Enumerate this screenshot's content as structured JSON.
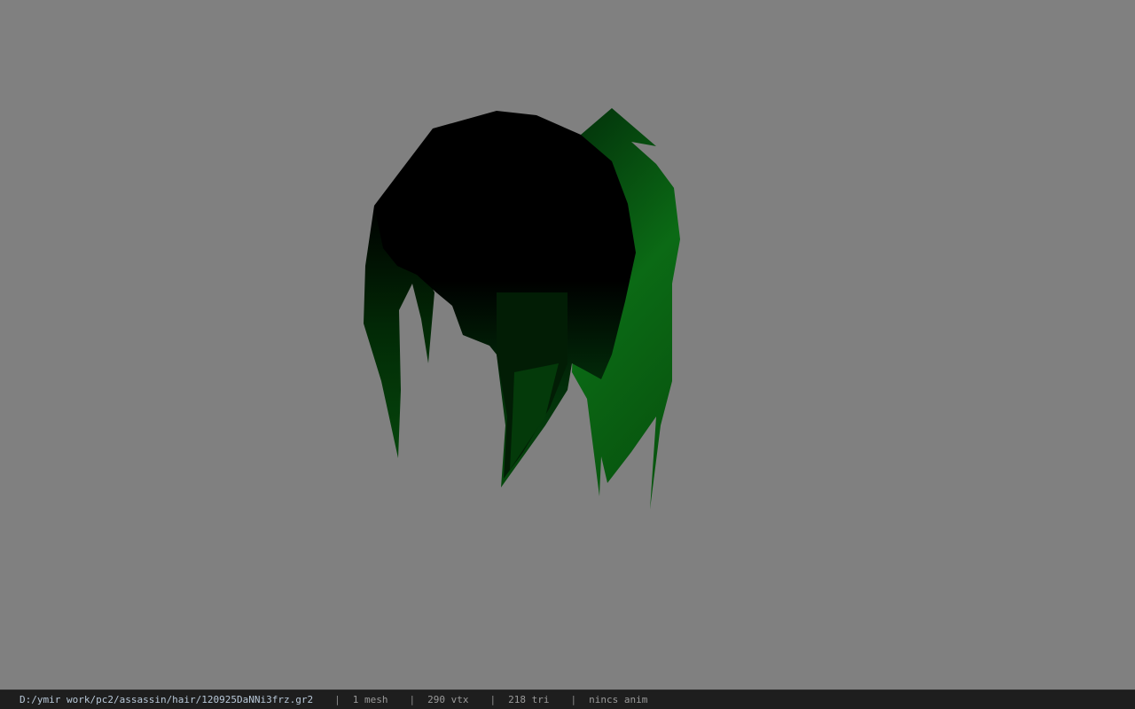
{
  "viewport": {
    "background_color": "#808080",
    "model": {
      "subject": "hair-mesh",
      "colors": {
        "dark": "#000000",
        "mid": "#013a06",
        "light": "#0b6e14"
      }
    }
  },
  "status_bar": {
    "file_path": "D:/ymir work/pc2/assassin/hair/120925DaNNi3frz.gr2",
    "separator": "|",
    "mesh_count": "1 mesh",
    "vertex_count": "290 vtx",
    "triangle_count": "218 tri",
    "anim_status": "nincs anim"
  }
}
